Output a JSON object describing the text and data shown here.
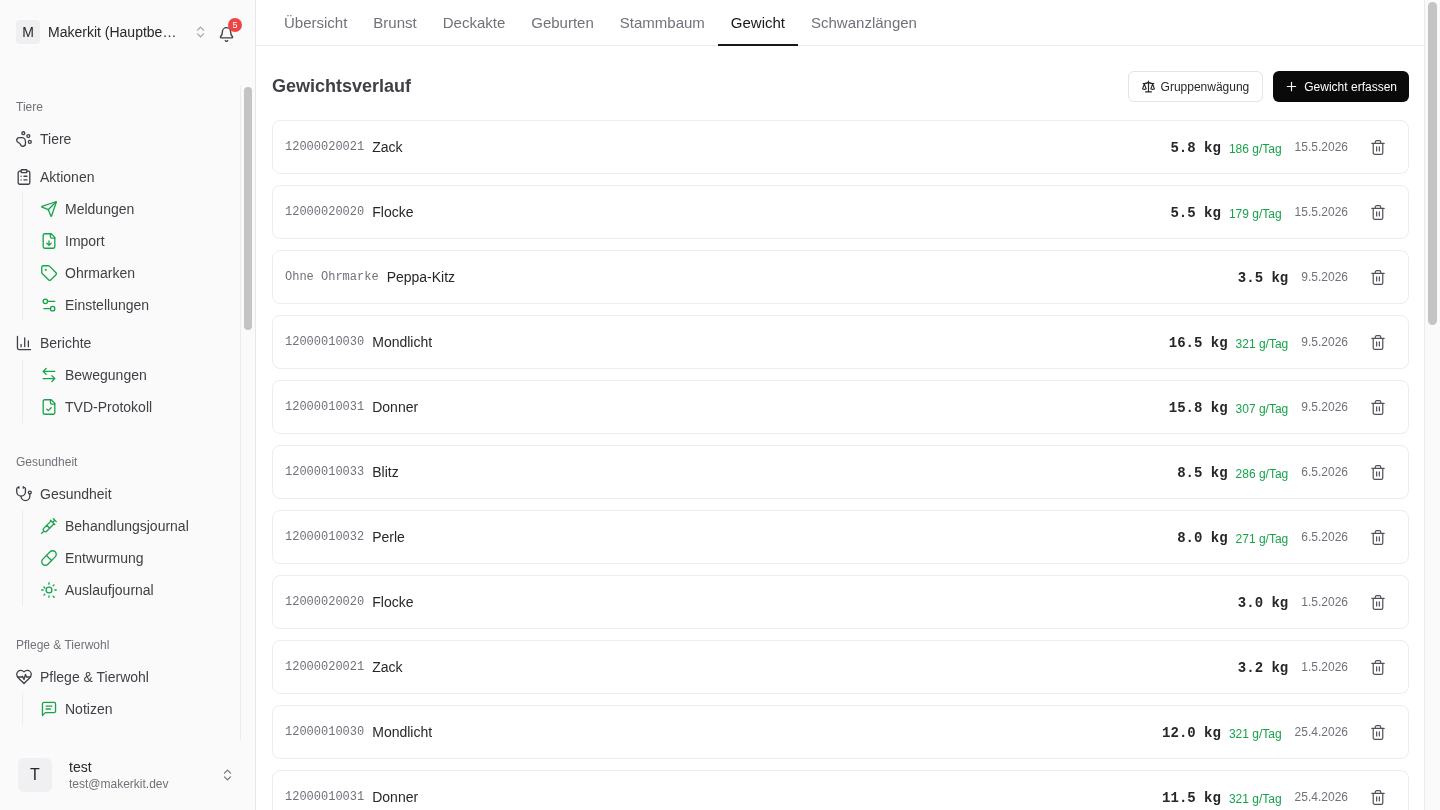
{
  "sidebar": {
    "account": {
      "initial": "M",
      "name": "Makerkit (Hauptbe…"
    },
    "notifications": {
      "count": "5"
    },
    "sections": [
      {
        "label": "Tiere",
        "items": [
          {
            "label": "Tiere"
          },
          {
            "label": "Aktionen",
            "children": [
              {
                "label": "Meldungen"
              },
              {
                "label": "Import"
              },
              {
                "label": "Ohrmarken"
              },
              {
                "label": "Einstellungen"
              }
            ]
          },
          {
            "label": "Berichte",
            "children": [
              {
                "label": "Bewegungen"
              },
              {
                "label": "TVD-Protokoll"
              }
            ]
          }
        ]
      },
      {
        "label": "Gesundheit",
        "items": [
          {
            "label": "Gesundheit",
            "children": [
              {
                "label": "Behandlungsjournal"
              },
              {
                "label": "Entwurmung"
              },
              {
                "label": "Auslaufjournal"
              }
            ]
          }
        ]
      },
      {
        "label": "Pflege & Tierwohl",
        "items": [
          {
            "label": "Pflege & Tierwohl",
            "children": [
              {
                "label": "Notizen"
              }
            ]
          }
        ]
      }
    ],
    "user": {
      "initial": "T",
      "name": "test",
      "email": "test@makerkit.dev"
    }
  },
  "tabs": [
    {
      "label": "Übersicht",
      "selected": false
    },
    {
      "label": "Brunst",
      "selected": false
    },
    {
      "label": "Deckakte",
      "selected": false
    },
    {
      "label": "Geburten",
      "selected": false
    },
    {
      "label": "Stammbaum",
      "selected": false
    },
    {
      "label": "Gewicht",
      "selected": true
    },
    {
      "label": "Schwanzlängen",
      "selected": false
    }
  ],
  "title": "Gewichtsverlauf",
  "actions": [
    {
      "kind": "outline",
      "label": "Gruppenwägung"
    },
    {
      "kind": "primary",
      "label": "Gewicht erfassen"
    }
  ],
  "entries": [
    {
      "ear_tag": "12000020021",
      "name": "Zack",
      "weight": "5.8 kg",
      "gain": "186 g/Tag",
      "date": "15.5.2026"
    },
    {
      "ear_tag": "12000020020",
      "name": "Flocke",
      "weight": "5.5 kg",
      "gain": "179 g/Tag",
      "date": "15.5.2026"
    },
    {
      "ear_tag": "Ohne Ohrmarke",
      "name": "Peppa-Kitz",
      "weight": "3.5 kg",
      "date": "9.5.2026"
    },
    {
      "ear_tag": "12000010030",
      "name": "Mondlicht",
      "weight": "16.5 kg",
      "gain": "321 g/Tag",
      "date": "9.5.2026"
    },
    {
      "ear_tag": "12000010031",
      "name": "Donner",
      "weight": "15.8 kg",
      "gain": "307 g/Tag",
      "date": "9.5.2026"
    },
    {
      "ear_tag": "12000010033",
      "name": "Blitz",
      "weight": "8.5 kg",
      "gain": "286 g/Tag",
      "date": "6.5.2026"
    },
    {
      "ear_tag": "12000010032",
      "name": "Perle",
      "weight": "8.0 kg",
      "gain": "271 g/Tag",
      "date": "6.5.2026"
    },
    {
      "ear_tag": "12000020020",
      "name": "Flocke",
      "weight": "3.0 kg",
      "date": "1.5.2026"
    },
    {
      "ear_tag": "12000020021",
      "name": "Zack",
      "weight": "3.2 kg",
      "date": "1.5.2026"
    },
    {
      "ear_tag": "12000010030",
      "name": "Mondlicht",
      "weight": "12.0 kg",
      "gain": "321 g/Tag",
      "date": "25.4.2026"
    },
    {
      "ear_tag": "12000010031",
      "name": "Donner",
      "weight": "11.5 kg",
      "gain": "321 g/Tag",
      "date": "25.4.2026"
    }
  ]
}
